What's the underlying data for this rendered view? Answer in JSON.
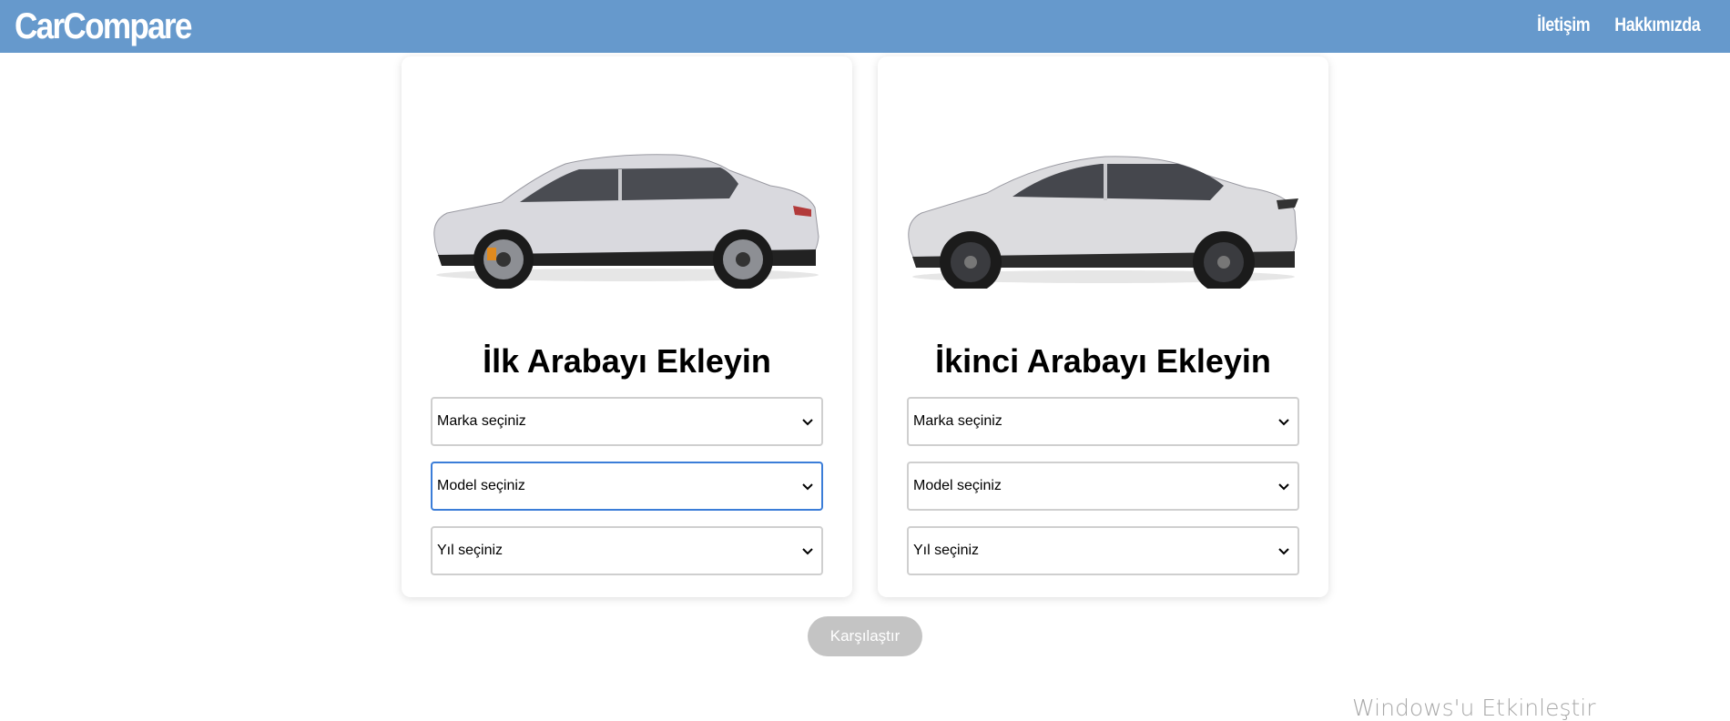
{
  "navbar": {
    "brand": "CarCompare",
    "links": [
      "İletişim",
      "Hakkımızda"
    ],
    "color": "#6699cc"
  },
  "cards": [
    {
      "title": "İlk Arabayı Ekleyin",
      "image_icon": "white-sedan-car-image",
      "selects": [
        {
          "value": "Marka seçiniz"
        },
        {
          "value": "Model seçiniz"
        },
        {
          "value": "Yıl seçiniz"
        }
      ]
    },
    {
      "title": "İkinci Arabayı Ekleyin",
      "image_icon": "white-suv-car-image",
      "selects": [
        {
          "value": "Marka seçiniz"
        },
        {
          "value": "Model seçiniz"
        },
        {
          "value": "Yıl seçiniz"
        }
      ]
    }
  ],
  "compare_button": {
    "label": "Karşılaştır",
    "color": "#c4c4c4"
  },
  "watermark": "Windows'u Etkinleştir"
}
